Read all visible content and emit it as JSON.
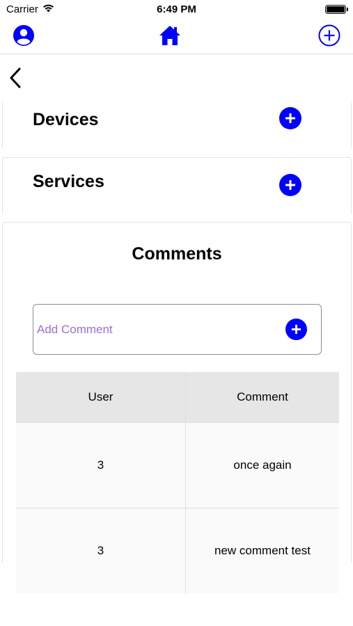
{
  "status_bar": {
    "carrier": "Carrier",
    "time": "6:49 PM"
  },
  "nav": {
    "profile_icon": "profile-icon",
    "home_icon": "home-icon",
    "add_icon": "add-circle-icon",
    "accent_color": "#0000ff"
  },
  "sections": {
    "devices": {
      "title": "Devices"
    },
    "services": {
      "title": "Services"
    }
  },
  "comments": {
    "title": "Comments",
    "input": {
      "placeholder": "Add Comment",
      "value": ""
    },
    "table": {
      "columns": [
        "User",
        "Comment"
      ],
      "rows": [
        {
          "user": "3",
          "comment": "once again"
        },
        {
          "user": "3",
          "comment": "new comment test"
        }
      ]
    }
  }
}
